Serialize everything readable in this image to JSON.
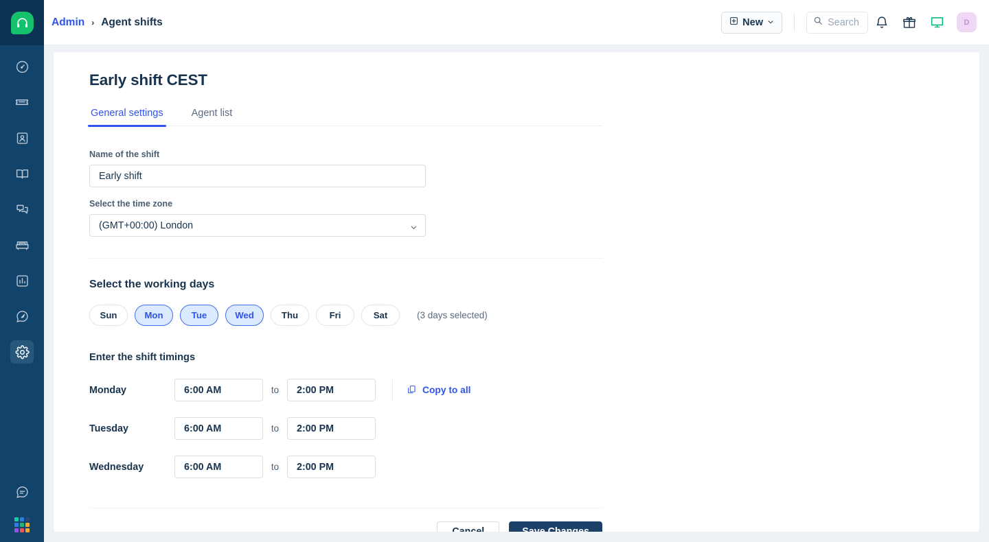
{
  "colors": {
    "rail_bg": "#12436b",
    "rail_logo_bg": "#15c26b",
    "accent_blue": "#2f54eb",
    "title_navy": "#17334d",
    "save_navy": "#1b4168",
    "chip_selected_bg": "#dbeafe",
    "avatar_bg": "#efd7f5",
    "page_bg": "#eef1f6"
  },
  "rail": {
    "logo_icon": "headset-logo-icon",
    "items": [
      {
        "icon": "dashboard-speedometer-icon",
        "active": false
      },
      {
        "icon": "ticket-icon",
        "active": false
      },
      {
        "icon": "contact-person-icon",
        "active": false
      },
      {
        "icon": "knowledge-base-book-icon",
        "active": false
      },
      {
        "icon": "chat-bubbles-icon",
        "active": false
      },
      {
        "icon": "customers-icon",
        "active": false
      },
      {
        "icon": "analytics-bar-chart-icon",
        "active": false
      },
      {
        "icon": "broadcast-message-icon",
        "active": false
      },
      {
        "icon": "settings-gear-icon",
        "active": true
      }
    ],
    "bottom_items": [
      {
        "icon": "feedback-speech-icon"
      }
    ],
    "apps_grid": {
      "icon": "apps-grid-icon",
      "swatches": [
        "#1dc8a8",
        "#2e7fe0",
        "#2a4a72",
        "#2e7fe0",
        "#22b573",
        "#f0a830",
        "#9b51e0",
        "#eb5757",
        "#f0a830"
      ]
    }
  },
  "topbar": {
    "breadcrumb": {
      "root": "Admin",
      "separator": "›",
      "current": "Agent shifts"
    },
    "new_button": {
      "label": "New",
      "icon": "plus-square-icon",
      "chevron_icon": "chevron-down-icon"
    },
    "search": {
      "placeholder": "Search",
      "icon": "search-icon",
      "value": ""
    },
    "icons": [
      {
        "name": "notification-bell-icon"
      },
      {
        "name": "gift-icon"
      },
      {
        "name": "monitor-screen-icon"
      }
    ],
    "avatar": {
      "initial": "D",
      "name": "user-avatar"
    }
  },
  "page": {
    "title": "Early shift CEST",
    "tabs": [
      {
        "label": "General settings",
        "active": true
      },
      {
        "label": "Agent list",
        "active": false
      }
    ]
  },
  "form": {
    "name_field": {
      "label": "Name of the shift",
      "value": "Early shift",
      "placeholder": "Name of the shift"
    },
    "timezone_field": {
      "label": "Select the time zone",
      "value": "(GMT+00:00) London",
      "chevron_icon": "chevron-down-icon"
    },
    "working_days": {
      "title": "Select the working days",
      "days": [
        {
          "label": "Sun",
          "selected": false
        },
        {
          "label": "Mon",
          "selected": true
        },
        {
          "label": "Tue",
          "selected": true
        },
        {
          "label": "Wed",
          "selected": true
        },
        {
          "label": "Thu",
          "selected": false
        },
        {
          "label": "Fri",
          "selected": false
        },
        {
          "label": "Sat",
          "selected": false
        }
      ],
      "note": "(3 days selected)"
    },
    "timings": {
      "title": "Enter the shift timings",
      "to_label": "to",
      "copy_to_all": {
        "label": "Copy to all",
        "icon": "copy-icon"
      },
      "rows": [
        {
          "day": "Monday",
          "start": "6:00 AM",
          "end": "2:00 PM",
          "has_copy": true
        },
        {
          "day": "Tuesday",
          "start": "6:00 AM",
          "end": "2:00 PM",
          "has_copy": false
        },
        {
          "day": "Wednesday",
          "start": "6:00 AM",
          "end": "2:00 PM",
          "has_copy": false
        }
      ]
    }
  },
  "actions": {
    "cancel_label": "Cancel",
    "save_label": "Save Changes"
  }
}
